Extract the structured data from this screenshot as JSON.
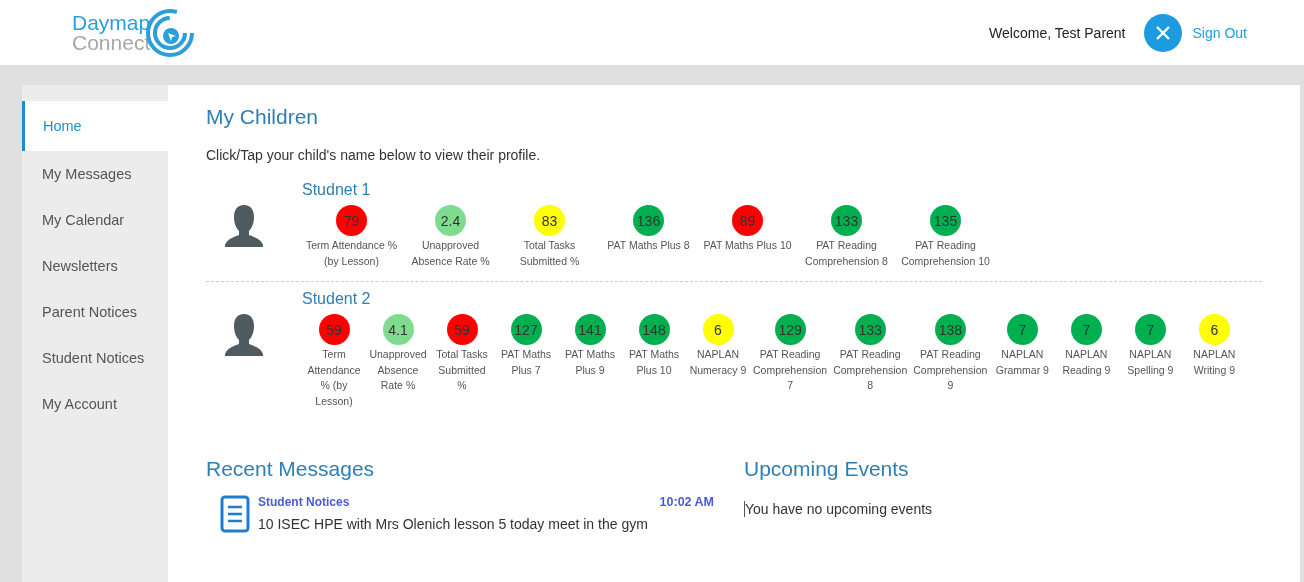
{
  "header": {
    "logo_top": "Daymap",
    "logo_bottom": "Connect",
    "welcome": "Welcome, Test Parent",
    "sign_out": "Sign Out"
  },
  "sidebar": {
    "items": [
      {
        "label": "Home",
        "selected": true
      },
      {
        "label": "My Messages",
        "selected": false
      },
      {
        "label": "My Calendar",
        "selected": false
      },
      {
        "label": "Newsletters",
        "selected": false
      },
      {
        "label": "Parent Notices",
        "selected": false
      },
      {
        "label": "Student Notices",
        "selected": false
      },
      {
        "label": "My Account",
        "selected": false
      }
    ]
  },
  "my_children": {
    "title": "My Children",
    "instruction": "Click/Tap your child's name below to view their profile.",
    "children": [
      {
        "name": "Studnet 1",
        "metrics": [
          {
            "value": "79",
            "label": "Term Attendance % (by Lesson)",
            "color": "#ff0000"
          },
          {
            "value": "2.4",
            "label": "Unapproved Absence Rate %",
            "color": "#7fdc8f"
          },
          {
            "value": "83",
            "label": "Total Tasks Submitted %",
            "color": "#ffff00"
          },
          {
            "value": "136",
            "label": "PAT Maths Plus 8",
            "color": "#00b050"
          },
          {
            "value": "89",
            "label": "PAT Maths Plus 10",
            "color": "#ff0000"
          },
          {
            "value": "133",
            "label": "PAT Reading Comprehension 8",
            "color": "#00b050"
          },
          {
            "value": "135",
            "label": "PAT Reading Comprehension 10",
            "color": "#00b050"
          }
        ]
      },
      {
        "name": "Student 2",
        "metrics": [
          {
            "value": "59",
            "label": "Term Attendance % (by Lesson)",
            "color": "#ff0000"
          },
          {
            "value": "4.1",
            "label": "Unapproved Absence Rate %",
            "color": "#7fdc8f"
          },
          {
            "value": "59",
            "label": "Total Tasks Submitted %",
            "color": "#ff0000"
          },
          {
            "value": "127",
            "label": "PAT Maths Plus 7",
            "color": "#00b050"
          },
          {
            "value": "141",
            "label": "PAT Maths Plus 9",
            "color": "#00b050"
          },
          {
            "value": "148",
            "label": "PAT Maths Plus 10",
            "color": "#00b050"
          },
          {
            "value": "6",
            "label": "NAPLAN Numeracy 9",
            "color": "#ffff00"
          },
          {
            "value": "129",
            "label": "PAT Reading Comprehension 7",
            "color": "#00b050"
          },
          {
            "value": "133",
            "label": "PAT Reading Comprehension 8",
            "color": "#00b050"
          },
          {
            "value": "138",
            "label": "PAT Reading Comprehension 9",
            "color": "#00b050"
          },
          {
            "value": "7",
            "label": "NAPLAN Grammar 9",
            "color": "#00b050"
          },
          {
            "value": "7",
            "label": "NAPLAN Reading 9",
            "color": "#00b050"
          },
          {
            "value": "7",
            "label": "NAPLAN Spelling 9",
            "color": "#00b050"
          },
          {
            "value": "6",
            "label": "NAPLAN Writing 9",
            "color": "#ffff00"
          }
        ]
      }
    ]
  },
  "recent_messages": {
    "title": "Recent Messages",
    "items": [
      {
        "source": "Student Notices",
        "time": "10:02 AM",
        "text": "10 ISEC HPE with Mrs Olenich lesson 5 today meet in the gym"
      }
    ]
  },
  "upcoming_events": {
    "title": "Upcoming Events",
    "empty_text": "You have no upcoming events"
  }
}
